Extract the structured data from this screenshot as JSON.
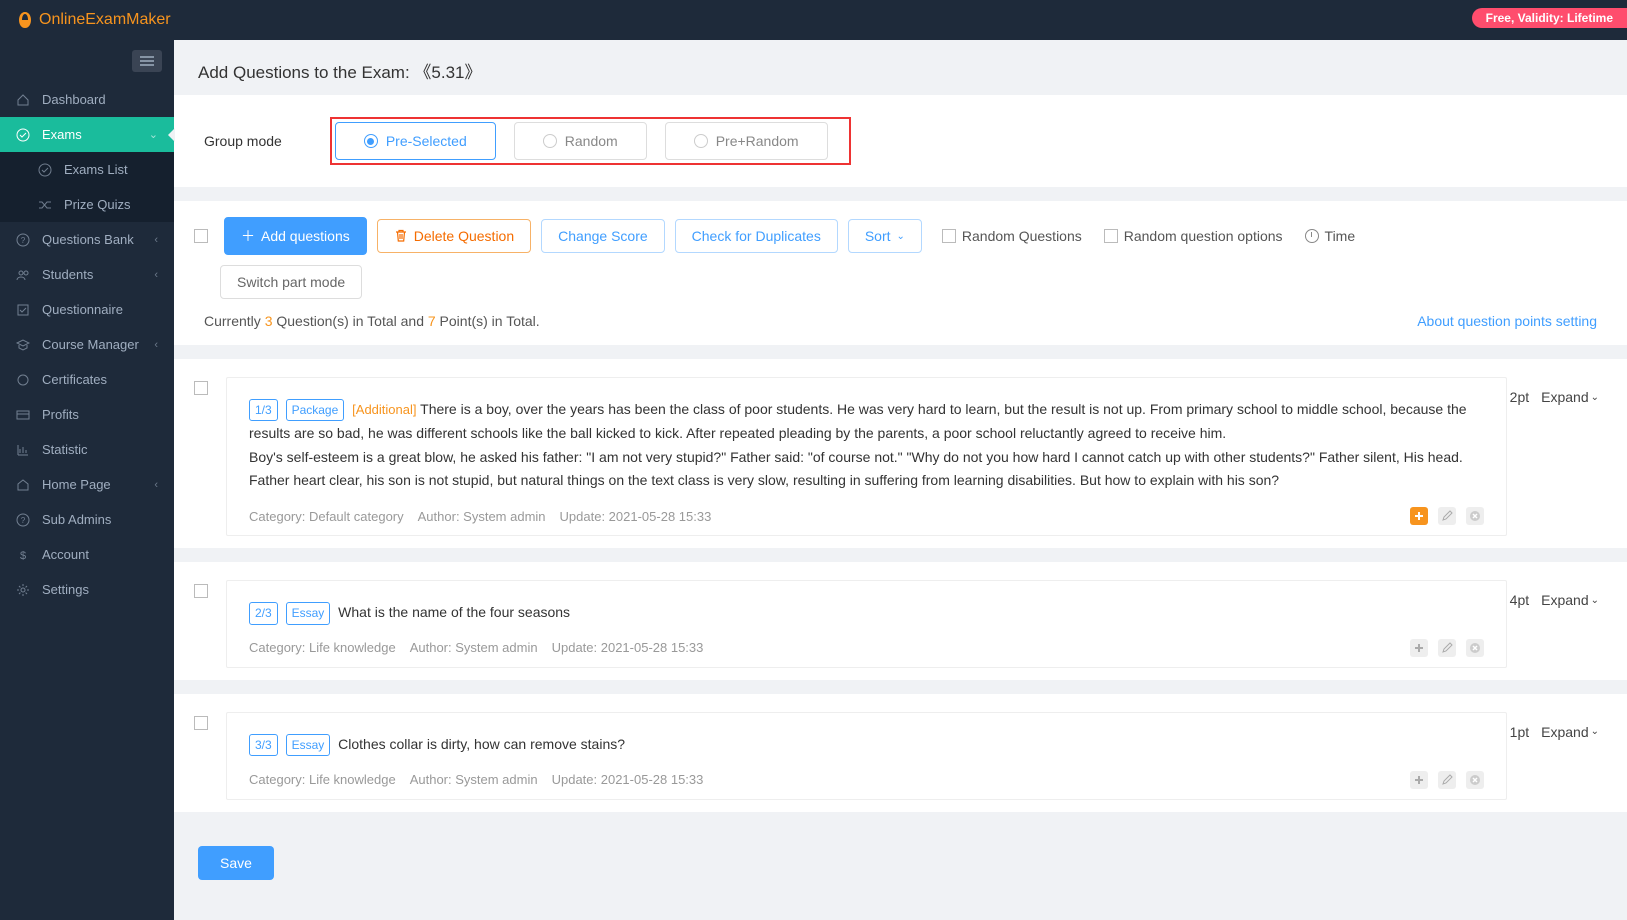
{
  "brand": "OnlineExamMaker",
  "topbar": {
    "badge": "Free, Validity: Lifetime"
  },
  "sidebar": {
    "items": [
      {
        "label": "Dashboard",
        "icon": "home"
      },
      {
        "label": "Exams",
        "icon": "check",
        "active": true,
        "chev": "down",
        "sub": [
          {
            "label": "Exams List",
            "icon": "check"
          },
          {
            "label": "Prize Quizs",
            "icon": "shuffle"
          }
        ]
      },
      {
        "label": "Questions Bank",
        "icon": "question",
        "chev": "left"
      },
      {
        "label": "Students",
        "icon": "users",
        "chev": "left"
      },
      {
        "label": "Questionnaire",
        "icon": "checkbox"
      },
      {
        "label": "Course Manager",
        "icon": "grad",
        "chev": "left"
      },
      {
        "label": "Certificates",
        "icon": "star"
      },
      {
        "label": "Profits",
        "icon": "card"
      },
      {
        "label": "Statistic",
        "icon": "chart"
      },
      {
        "label": "Home Page",
        "icon": "home2",
        "chev": "left"
      },
      {
        "label": "Sub Admins",
        "icon": "question"
      },
      {
        "label": "Account",
        "icon": "dollar"
      },
      {
        "label": "Settings",
        "icon": "gear"
      }
    ]
  },
  "page": {
    "title_prefix": "Add Questions to the Exam: ",
    "title_name": "《5.31》"
  },
  "group_mode": {
    "label": "Group mode",
    "options": [
      "Pre-Selected",
      "Random",
      "Pre+Random"
    ],
    "selected": 0
  },
  "toolbar": {
    "add": "Add questions",
    "delete": "Delete Question",
    "change_score": "Change Score",
    "check_dup": "Check for Duplicates",
    "sort": "Sort",
    "random_q": "Random Questions",
    "random_opt": "Random question options",
    "time": "Time",
    "switch_part": "Switch part mode"
  },
  "summary": {
    "currently": "Currently ",
    "q_count": "3",
    "q_mid": " Question(s) in Total and ",
    "pt_count": "7",
    "pt_end": " Point(s) in Total.",
    "link": "About question points setting"
  },
  "questions": [
    {
      "idx": "1/3",
      "type": "Package",
      "additional": "[Additional]",
      "text": "There is a boy, over the years has been the class of poor students. He was very hard to learn, but the result is not up. From primary school to middle school, because the results are so bad, he was different schools like the ball kicked to kick. After repeated pleading by the parents, a poor school reluctantly agreed to receive him.\nBoy's self-esteem is a great blow, he asked his father: \"I am not very stupid?\" Father said: \"of course not.\" \"Why do not you how hard I cannot catch up with other students?\" Father silent, His head.\nFather heart clear, his son is not stupid, but natural things on the text class is very slow, resulting in suffering from learning disabilities. But how to explain with his son?",
      "points": "2pt",
      "category": "Default category",
      "author": "System admin",
      "update": "2021-05-28 15:33",
      "add_hi": true,
      "truncate": true
    },
    {
      "idx": "2/3",
      "type": "Essay",
      "text": "What is the name of the four seasons",
      "points": "4pt",
      "category": "Life knowledge",
      "author": "System admin",
      "update": "2021-05-28 15:33"
    },
    {
      "idx": "3/3",
      "type": "Essay",
      "text": "Clothes collar is dirty, how can remove stains?",
      "points": "1pt",
      "category": "Life knowledge",
      "author": "System admin",
      "update": "2021-05-28 15:33"
    }
  ],
  "labels": {
    "expand": "Expand",
    "category": "Category: ",
    "author": "Author: ",
    "update": "Update: ",
    "save": "Save"
  }
}
